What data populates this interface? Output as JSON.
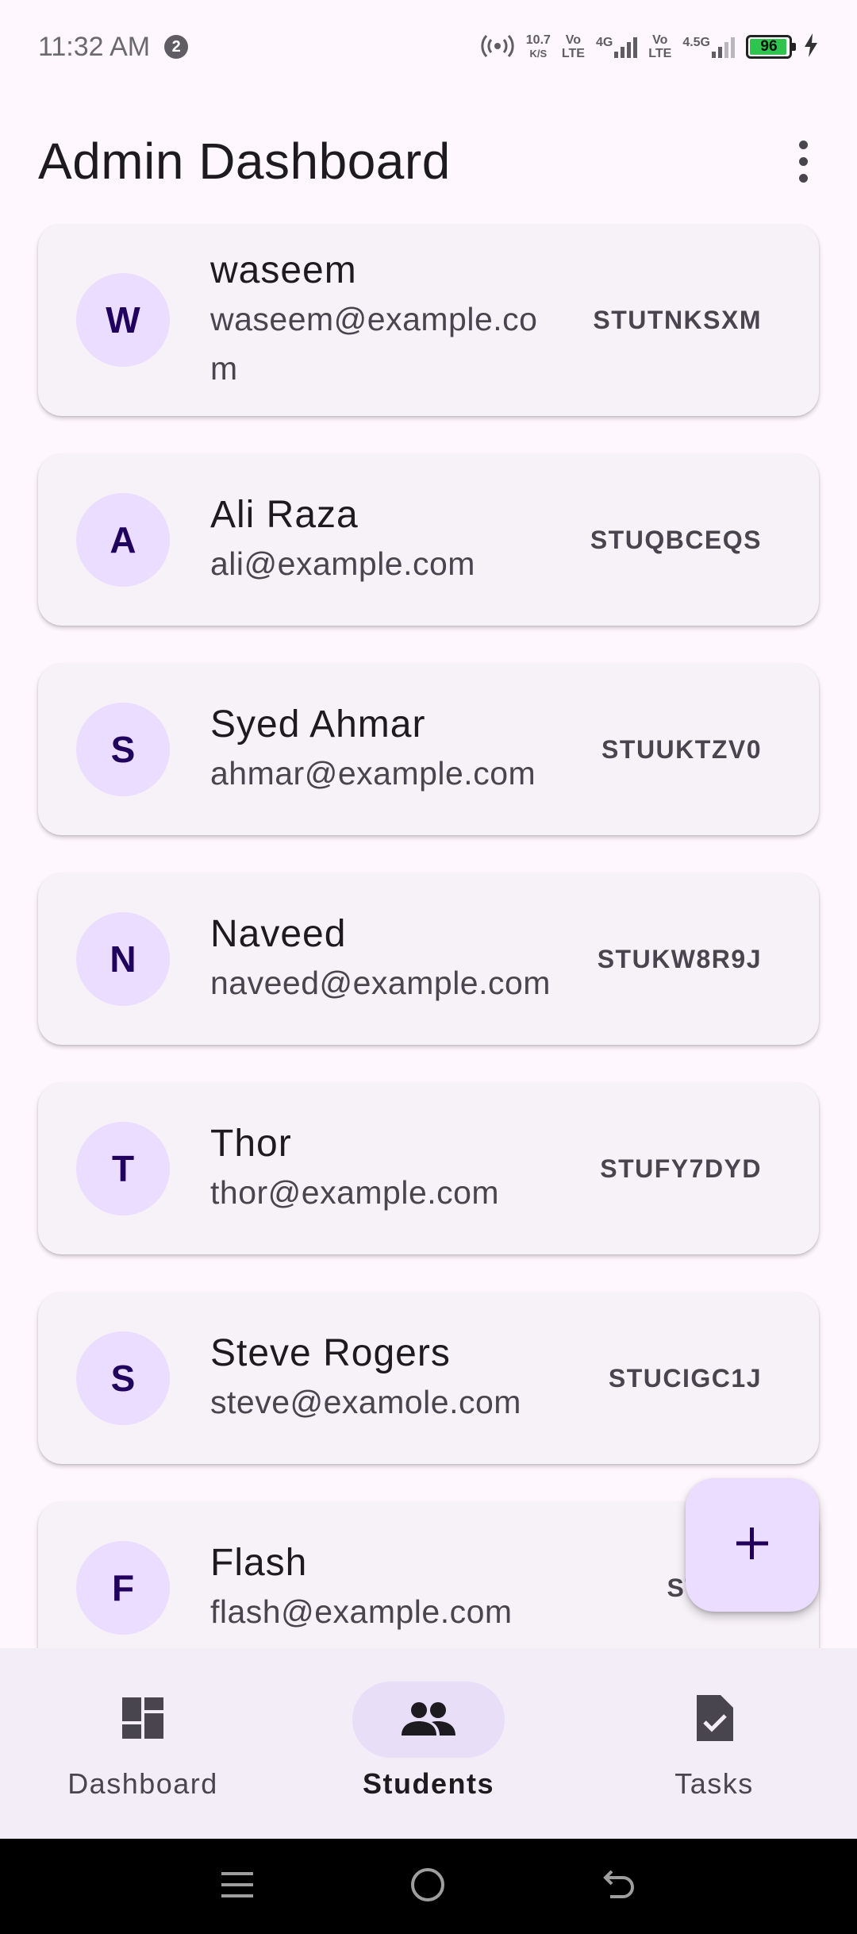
{
  "status_bar": {
    "time": "11:32 AM",
    "notification_count": "2",
    "net_speed_value": "10.7",
    "net_speed_unit": "K/S",
    "sim1_vo": "Vo",
    "sim1_lte": "LTE",
    "sim1_network": "4G",
    "sim2_vo": "Vo",
    "sim2_lte": "LTE",
    "sim2_network": "4.5G",
    "battery_level": "96",
    "battery_fraction": 0.96
  },
  "app_bar": {
    "title": "Admin Dashboard",
    "more_icon": "more-vert-icon"
  },
  "students": [
    {
      "initial": "W",
      "name": "waseem",
      "email": "waseem@example.com",
      "id": "STUTNKSXM"
    },
    {
      "initial": "A",
      "name": "Ali Raza",
      "email": "ali@example.com",
      "id": "STUQBCEQS"
    },
    {
      "initial": "S",
      "name": "Syed Ahmar",
      "email": "ahmar@example.com",
      "id": "STUUKTZV0"
    },
    {
      "initial": "N",
      "name": "Naveed",
      "email": "naveed@example.com",
      "id": "STUKW8R9J"
    },
    {
      "initial": "T",
      "name": "Thor",
      "email": "thor@example.com",
      "id": "STUFY7DYD"
    },
    {
      "initial": "S",
      "name": "Steve Rogers",
      "email": "steve@examole.com",
      "id": "STUCIGC1J"
    },
    {
      "initial": "F",
      "name": "Flash",
      "email": "flash@example.com",
      "id": "STU8W"
    }
  ],
  "fab": {
    "icon": "add-icon"
  },
  "bottom_nav": {
    "items": [
      {
        "label": "Dashboard",
        "icon": "dashboard-icon",
        "active": false
      },
      {
        "label": "Students",
        "icon": "people-icon",
        "active": true
      },
      {
        "label": "Tasks",
        "icon": "task-icon",
        "active": false
      }
    ]
  },
  "colors": {
    "background": "#fef7fd",
    "card": "#f7f1f8",
    "avatar": "#eaddff",
    "accent_text": "#21005d",
    "nav_bar": "#f3edf7",
    "nav_active_pill": "#e8def8"
  }
}
